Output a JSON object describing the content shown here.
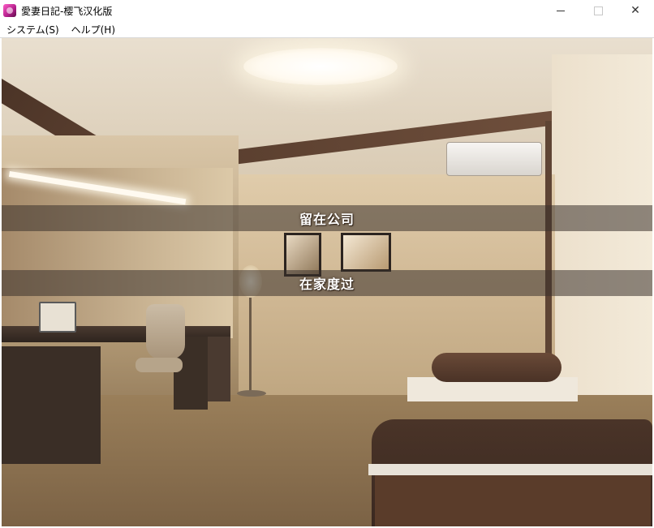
{
  "window": {
    "title": "愛妻日記-樱飞汉化版",
    "controls": {
      "minimize_icon": "minimize-icon",
      "maximize_icon": "maximize-icon",
      "close_icon": "close-icon",
      "close_glyph": "✕"
    }
  },
  "menu": {
    "items": [
      "システム(S)",
      "ヘルプ(H)"
    ]
  },
  "scene": {
    "background": "bedroom",
    "choices": [
      "留在公司",
      "在家度过"
    ]
  },
  "colors": {
    "choice_bar": "#3a322c",
    "choice_text": "#ffffff",
    "app_icon": "#d13aa0"
  }
}
